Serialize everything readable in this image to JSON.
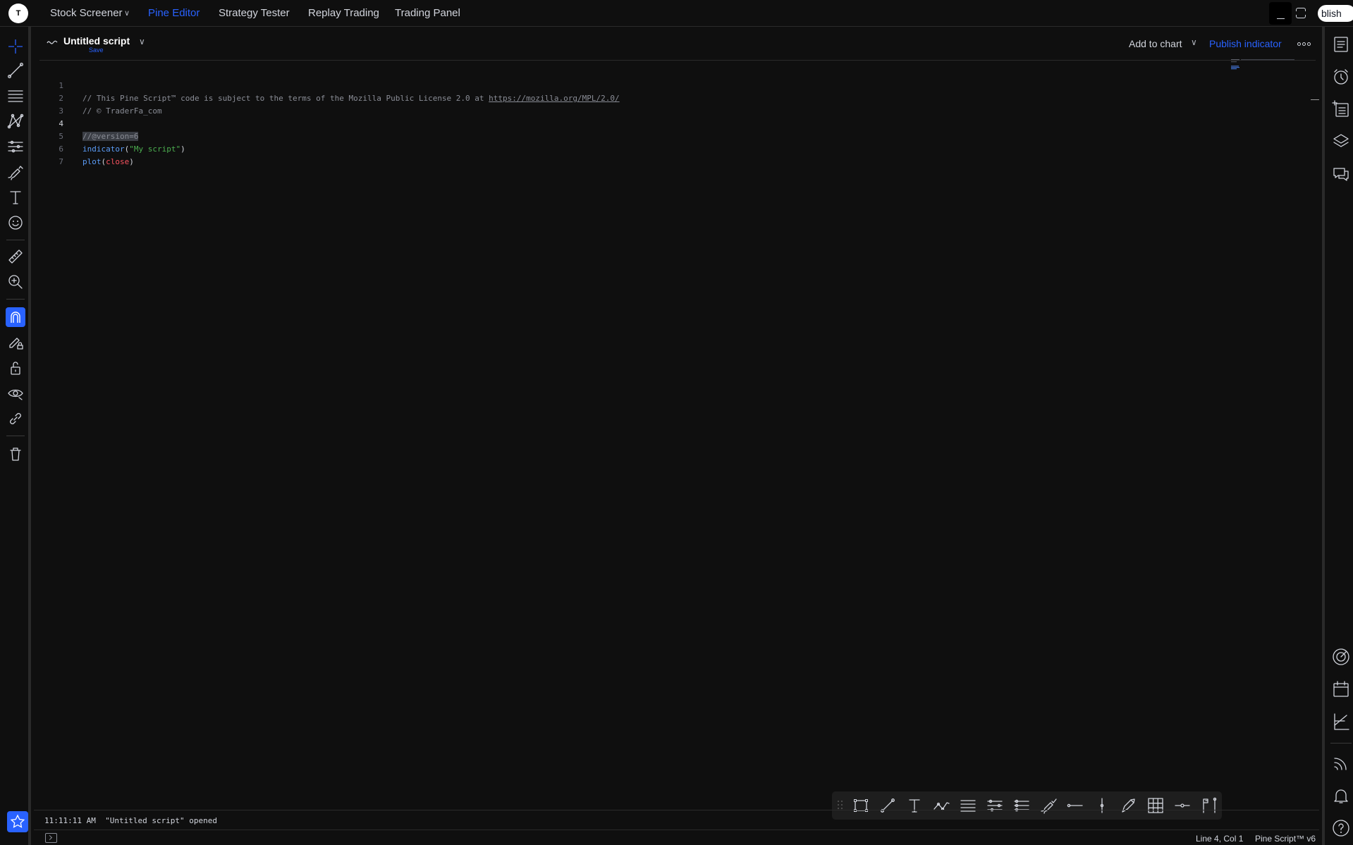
{
  "app": {
    "logo_text": "T",
    "publish_pill_label": "blish"
  },
  "top_tabs": [
    {
      "label": "Stock Screener",
      "has_dropdown": true,
      "active": false
    },
    {
      "label": "Pine Editor",
      "has_dropdown": false,
      "active": true
    },
    {
      "label": "Strategy Tester",
      "has_dropdown": false,
      "active": false
    },
    {
      "label": "Replay Trading",
      "has_dropdown": false,
      "active": false
    },
    {
      "label": "Trading Panel",
      "has_dropdown": false,
      "active": false
    }
  ],
  "editor_header": {
    "script_title": "Untitled script",
    "save_label": "Save",
    "add_to_chart_label": "Add to chart",
    "publish_label": "Publish indicator"
  },
  "code": {
    "current_line": 4,
    "lines": [
      {
        "num": "1",
        "comment_prefix": "// This Pine Script™ code is subject to the terms of the Mozilla Public License 2.0 at ",
        "url": "https://mozilla.org/MPL/2.0/"
      },
      {
        "num": "2",
        "comment": "// © TraderFa_com"
      },
      {
        "num": "3"
      },
      {
        "num": "4",
        "version": "//@version=6"
      },
      {
        "num": "5",
        "fn": "indicator",
        "open": "(",
        "str": "\"My script\"",
        "close": ")"
      },
      {
        "num": "6",
        "fn": "plot",
        "open": "(",
        "var": "close",
        "close": ")"
      },
      {
        "num": "7"
      }
    ]
  },
  "console": {
    "message": "11:11:11 AM  \"Untitled script\" opened"
  },
  "status_bar": {
    "cursor_position": "Line 4, Col 1",
    "language_version": "Pine Script™ v6"
  },
  "colors": {
    "accent": "#2962ff",
    "background": "#0f0f0f",
    "text": "#d1d4dc",
    "comment": "#8a8d96",
    "keyword_fn": "#5b9cf6",
    "string": "#4caf50",
    "variable": "#f7525f"
  },
  "icons": {
    "left_toolbar": [
      "crosshair-icon",
      "trend-line-icon",
      "fib-retracement-icon",
      "pattern-icon",
      "prediction-icon",
      "brush-icon",
      "text-icon",
      "emoji-icon",
      "ruler-icon",
      "zoom-in-icon",
      "magnet-icon",
      "lock-drawing-icon",
      "unlock-icon",
      "eye-icon",
      "link-icon",
      "trash-icon",
      "star-icon"
    ],
    "right_toolbar": [
      "watchlist-icon",
      "alert-clock-icon",
      "add-list-icon",
      "layers-icon",
      "chat-icon",
      "target-icon",
      "calendar-icon",
      "chart-lines-icon",
      "rss-icon",
      "bell-icon",
      "help-icon"
    ],
    "floating_toolbar": [
      "rectangle-icon",
      "line-icon",
      "text-icon",
      "path-icon",
      "parallel-channel-icon",
      "fib-channel-icon",
      "pitchfork-icon",
      "brush-check-icon",
      "horizontal-ray-icon",
      "vertical-line-icon",
      "arrow-pen-icon",
      "grid-icon",
      "horizontal-line-icon",
      "flag-pole-icon"
    ]
  }
}
